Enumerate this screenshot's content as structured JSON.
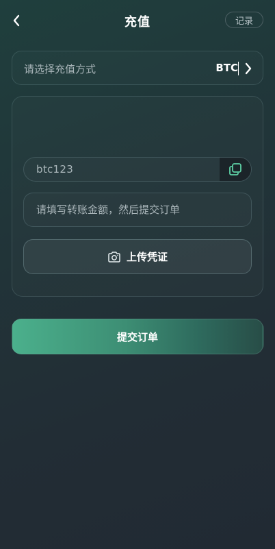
{
  "header": {
    "title": "充值",
    "record_label": "记录"
  },
  "method": {
    "placeholder": "请选择充值方式",
    "value": "BTC"
  },
  "deposit": {
    "address": "btc123",
    "amount_placeholder": "请填写转账金额，然后提交订单",
    "upload_label": "上传凭证"
  },
  "submit": {
    "label": "提交订单"
  },
  "colors": {
    "accent": "#4bb08c",
    "background": "#222d35"
  },
  "icons": {
    "back": "chevron-left-icon",
    "method_arrow": "chevron-right-icon",
    "copy": "copy-icon",
    "upload": "camera-icon"
  }
}
